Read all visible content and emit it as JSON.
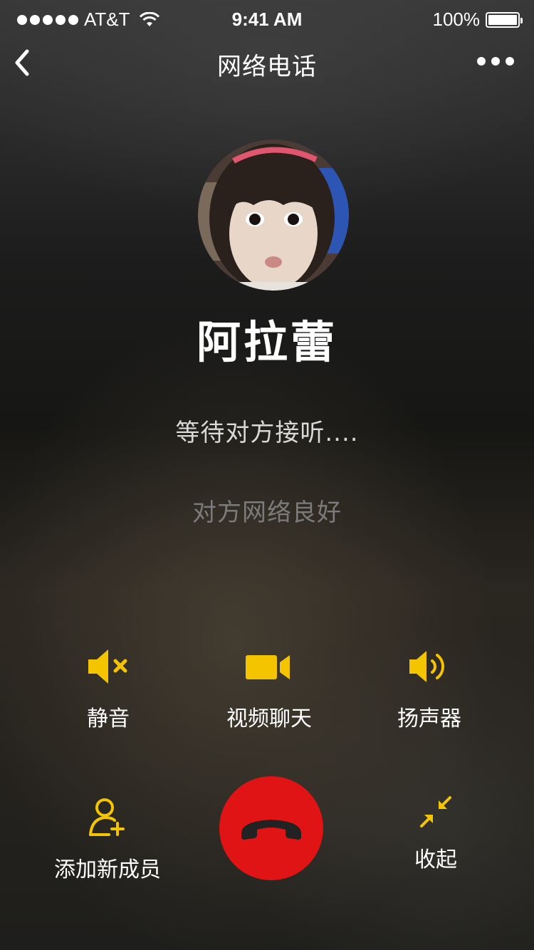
{
  "status_bar": {
    "carrier": "AT&T",
    "time": "9:41 AM",
    "battery": "100%"
  },
  "nav": {
    "title": "网络电话",
    "back_icon": "chevron-left-icon",
    "more_icon": "more-horizontal-icon"
  },
  "contact": {
    "name": "阿拉蕾"
  },
  "call": {
    "status": "等待对方接听....",
    "network": "对方网络良好"
  },
  "controls": {
    "mute": {
      "label": "静音",
      "icon": "speaker-mute-icon"
    },
    "video": {
      "label": "视频聊天",
      "icon": "video-camera-icon"
    },
    "speaker": {
      "label": "扬声器",
      "icon": "speaker-volume-icon"
    },
    "add_member": {
      "label": "添加新成员",
      "icon": "add-user-icon"
    },
    "hangup": {
      "icon": "phone-hangup-icon"
    },
    "minimize": {
      "label": "收起",
      "icon": "minimize-arrows-icon"
    }
  },
  "colors": {
    "accent": "#F5C400",
    "hangup": "#E01414"
  }
}
